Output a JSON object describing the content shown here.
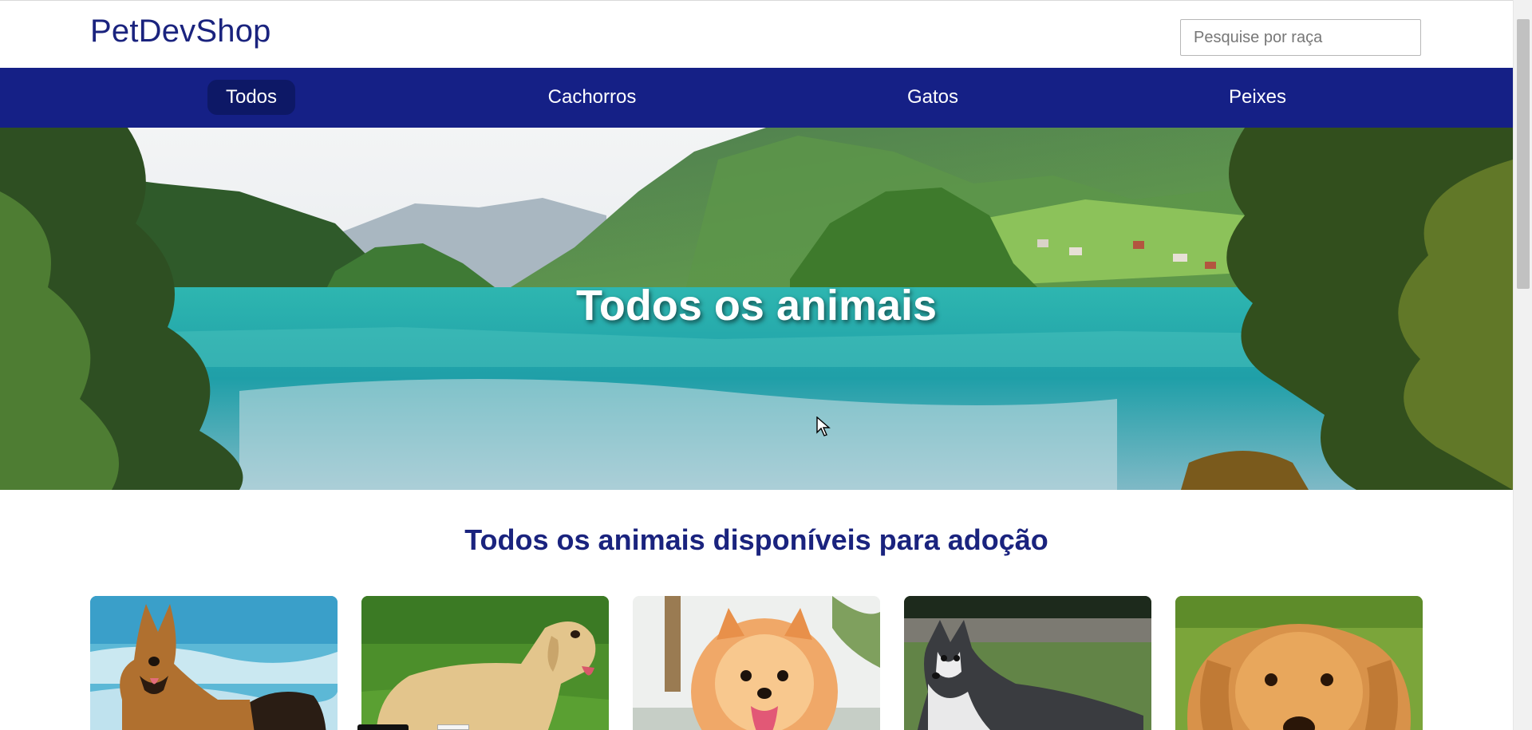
{
  "header": {
    "logo": "PetDevShop",
    "search": {
      "placeholder": "Pesquise por raça",
      "value": ""
    }
  },
  "nav": {
    "items": [
      {
        "label": "Todos",
        "active": true
      },
      {
        "label": "Cachorros",
        "active": false
      },
      {
        "label": "Gatos",
        "active": false
      },
      {
        "label": "Peixes",
        "active": false
      }
    ]
  },
  "hero": {
    "title": "Todos os animais"
  },
  "section": {
    "title": "Todos os animais disponíveis para adoção"
  },
  "cards": [
    {
      "icon": "german-shepherd-photo"
    },
    {
      "icon": "labrador-photo"
    },
    {
      "icon": "pomeranian-photo"
    },
    {
      "icon": "husky-photo"
    },
    {
      "icon": "golden-retriever-photo"
    }
  ],
  "colors": {
    "brand": "#1a237e",
    "nav_background": "#152086",
    "nav_active": "#0d1866"
  }
}
